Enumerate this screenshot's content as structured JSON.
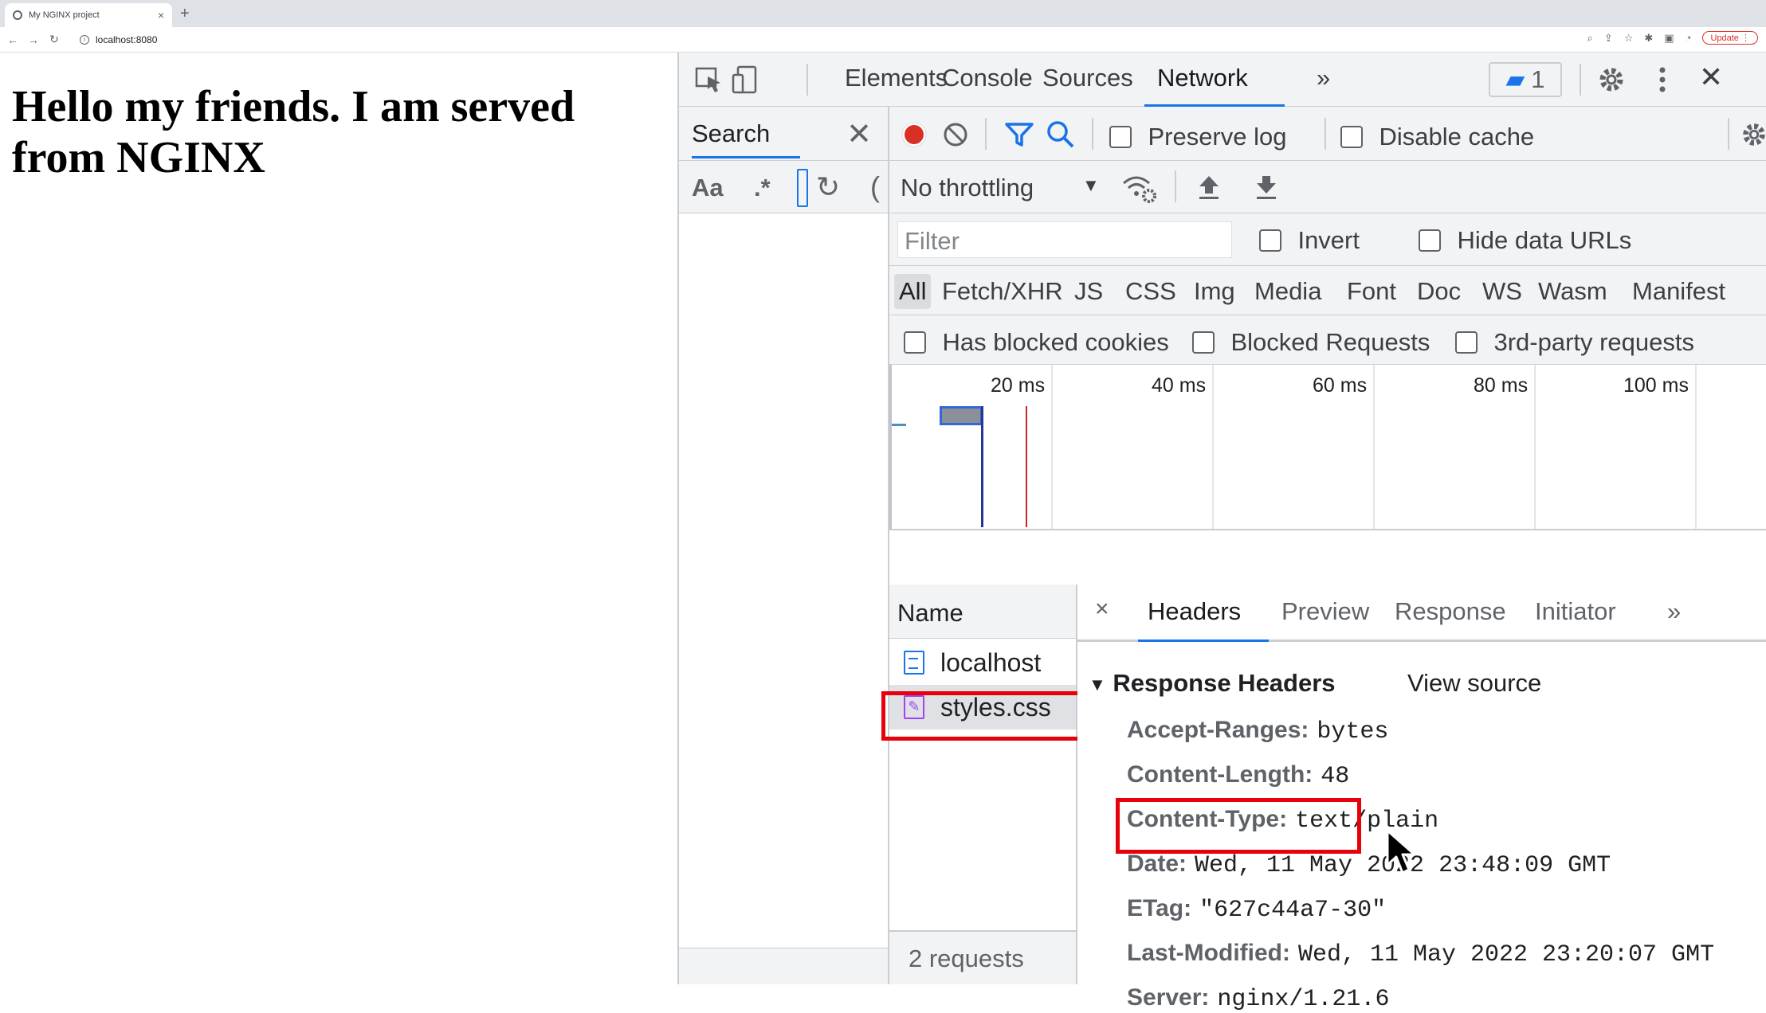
{
  "browser": {
    "tab_title": "My NGINX project",
    "tab_close": "×",
    "new_tab": "+",
    "url": "localhost:8080",
    "update_label": "Update",
    "nav": {
      "back": "←",
      "forward": "→",
      "reload": "↻"
    }
  },
  "page": {
    "heading": "Hello my friends. I am served from NGINX"
  },
  "devtools": {
    "tabs": [
      "Elements",
      "Console",
      "Sources",
      "Network"
    ],
    "active_tab": "Network",
    "more": "»",
    "issues_count": "1",
    "close": "✕",
    "search": {
      "title": "Search",
      "close": "✕",
      "match_case": "Aa",
      "regex": ".*"
    },
    "network": {
      "preserve_log": "Preserve log",
      "disable_cache": "Disable cache",
      "throttling": "No throttling",
      "filter_placeholder": "Filter",
      "invert": "Invert",
      "hide_data_urls": "Hide data URLs",
      "types": [
        "All",
        "Fetch/XHR",
        "JS",
        "CSS",
        "Img",
        "Media",
        "Font",
        "Doc",
        "WS",
        "Wasm",
        "Manifest"
      ],
      "active_type": "All",
      "has_blocked_cookies": "Has blocked cookies",
      "blocked_requests": "Blocked Requests",
      "third_party": "3rd-party requests",
      "timeline_ticks": [
        "20 ms",
        "40 ms",
        "60 ms",
        "80 ms",
        "100 ms"
      ],
      "name_header": "Name",
      "requests": [
        {
          "name": "localhost",
          "type": "document"
        },
        {
          "name": "styles.css",
          "type": "stylesheet"
        }
      ],
      "selected_request": "styles.css",
      "summary": "2 requests"
    },
    "details": {
      "close": "×",
      "tabs": [
        "Headers",
        "Preview",
        "Response",
        "Initiator"
      ],
      "active_tab": "Headers",
      "more": "»",
      "section_title": "Response Headers",
      "view_source": "View source",
      "headers": [
        {
          "key": "Accept-Ranges:",
          "value": "bytes"
        },
        {
          "key": "Content-Length:",
          "value": "48"
        },
        {
          "key": "Content-Type:",
          "value": "text/plain"
        },
        {
          "key": "Date:",
          "value": "Wed, 11 May 2022 23:48:09 GMT"
        },
        {
          "key": "ETag:",
          "value": "\"627c44a7-30\""
        },
        {
          "key": "Last-Modified:",
          "value": "Wed, 11 May 2022 23:20:07 GMT"
        },
        {
          "key": "Server:",
          "value": "nginx/1.21.6"
        }
      ],
      "highlighted_header": "Content-Type:"
    }
  },
  "colors": {
    "accent": "#1a73e8",
    "record_red": "#d93025",
    "highlight_box": "#e8000b"
  }
}
